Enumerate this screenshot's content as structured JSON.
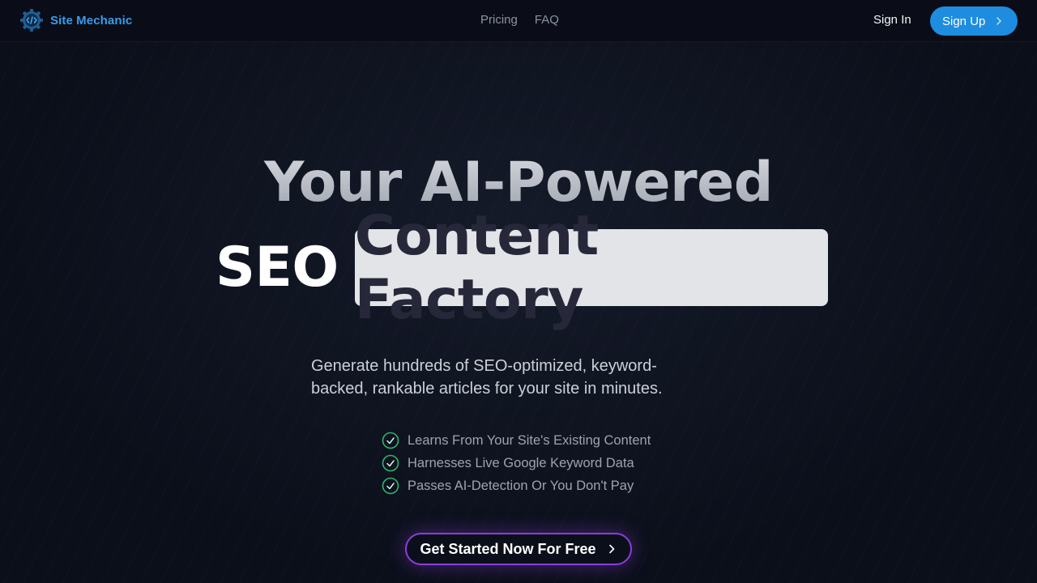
{
  "header": {
    "brand": "Site Mechanic",
    "nav": [
      "Pricing",
      "FAQ"
    ],
    "sign_in": "Sign In",
    "sign_up": "Sign Up"
  },
  "hero": {
    "title_line1": "Your AI-Powered",
    "title_line2_plain": "SEO",
    "title_line2_highlight": "Content Factory",
    "subtitle": "Generate hundreds of SEO-optimized, keyword-backed, rankable articles for your site in minutes.",
    "features": [
      "Learns From Your Site's Existing Content",
      "Harnesses Live Google Keyword Data",
      "Passes AI-Detection Or You Don't Pay"
    ],
    "cta": "Get Started Now For Free"
  },
  "colors": {
    "background": "#0b0f1a",
    "brand": "#3b9be8",
    "signup_bg": "#1e8de0",
    "check": "#2fb56a",
    "cta_border": "#8b3ddb",
    "highlight_bg": "#e3e4e7"
  },
  "icons": {
    "logo": "gear-code-icon",
    "chevron": "chevron-right-icon",
    "check": "check-circle-icon"
  }
}
